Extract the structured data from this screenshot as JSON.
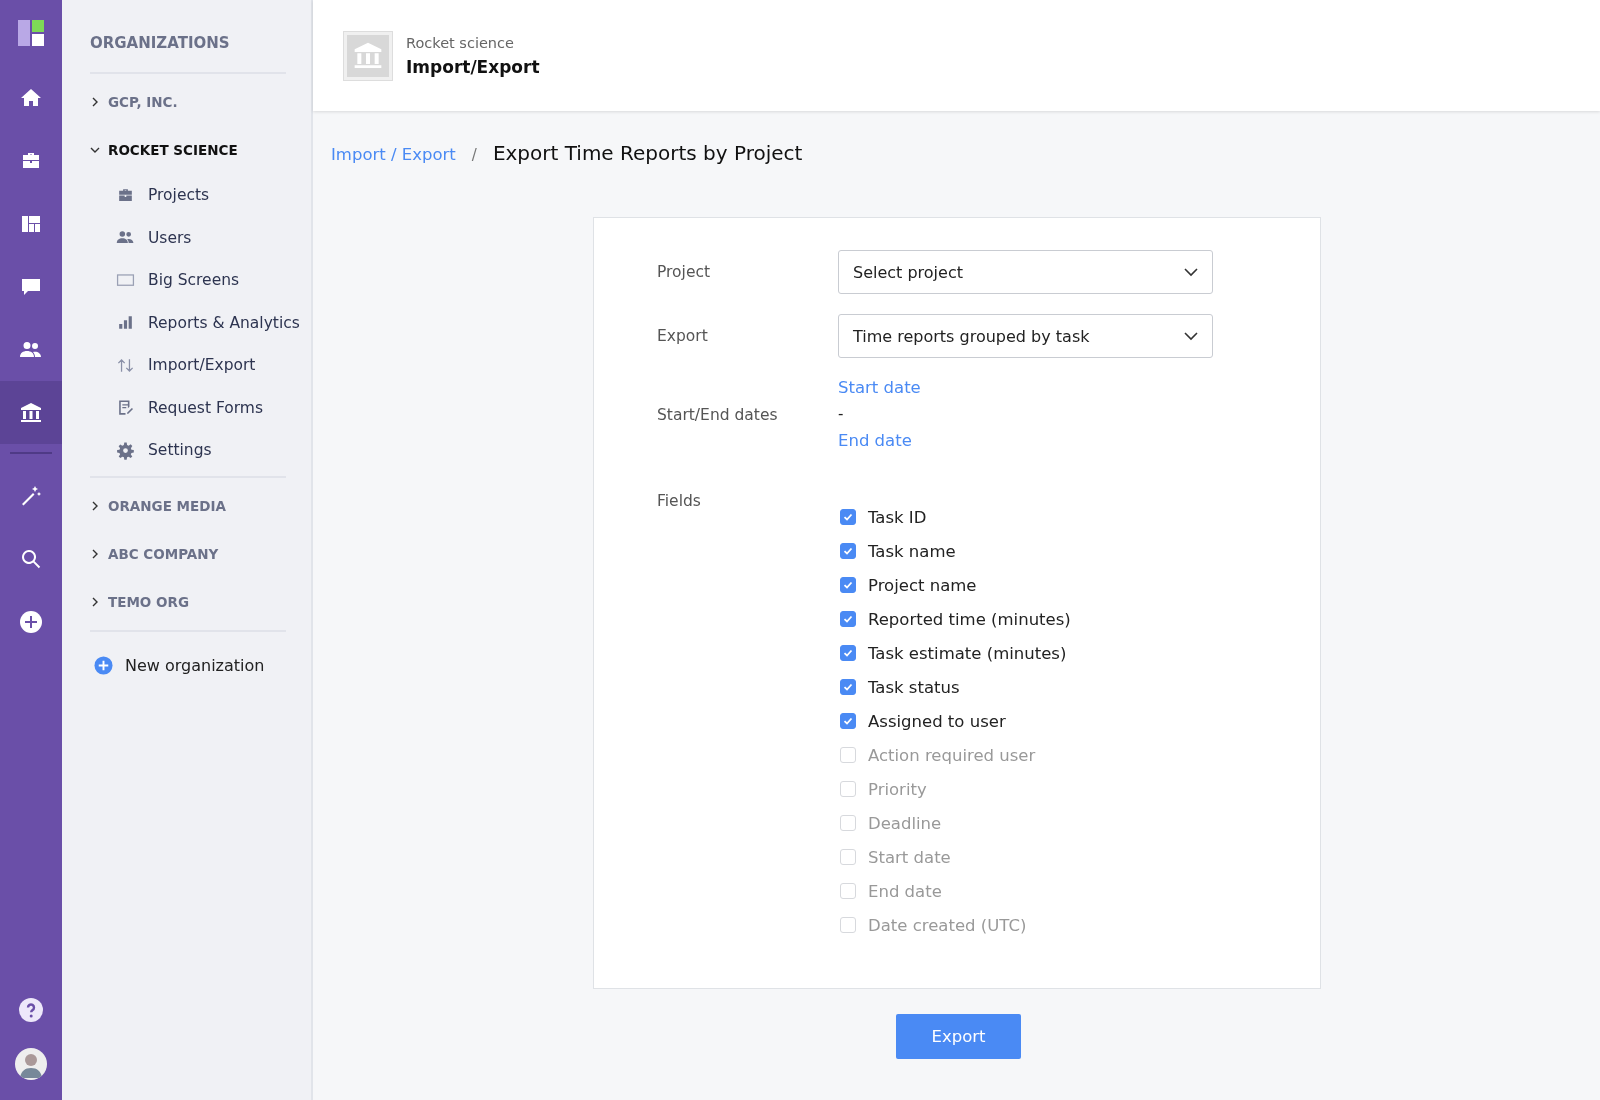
{
  "rail": {
    "items": [
      {
        "selected": false
      },
      {
        "selected": false
      },
      {
        "selected": false
      },
      {
        "selected": false
      },
      {
        "selected": false
      },
      {
        "selected": true
      },
      {
        "selected": false
      },
      {
        "selected": false
      },
      {
        "selected": false
      }
    ]
  },
  "sidebar": {
    "heading": "ORGANIZATIONS",
    "organizations": [
      {
        "name": "GCP, INC.",
        "expanded": false
      },
      {
        "name": "ROCKET SCIENCE",
        "expanded": true,
        "children": [
          {
            "label": "Projects"
          },
          {
            "label": "Users"
          },
          {
            "label": "Big Screens"
          },
          {
            "label": "Reports & Analytics"
          },
          {
            "label": "Import/Export"
          },
          {
            "label": "Request Forms"
          },
          {
            "label": "Settings"
          }
        ]
      },
      {
        "name": "ORANGE MEDIA",
        "expanded": false
      },
      {
        "name": "ABC COMPANY",
        "expanded": false
      },
      {
        "name": "TEMO ORG",
        "expanded": false
      }
    ],
    "new_organization": "New organization"
  },
  "header": {
    "subtitle": "Rocket science",
    "title": "Import/Export"
  },
  "breadcrumb": {
    "link": "Import / Export",
    "separator": "/",
    "current": "Export Time Reports by Project"
  },
  "form": {
    "project": {
      "label": "Project",
      "value": "Select project"
    },
    "export": {
      "label": "Export",
      "value": "Time reports grouped by task"
    },
    "dates": {
      "label": "Start/End dates",
      "start": "Start date",
      "separator": "-",
      "end": "End date"
    },
    "fields_label": "Fields",
    "fields": [
      {
        "label": "Task ID",
        "checked": true
      },
      {
        "label": "Task name",
        "checked": true
      },
      {
        "label": "Project name",
        "checked": true
      },
      {
        "label": "Reported time (minutes)",
        "checked": true
      },
      {
        "label": "Task estimate (minutes)",
        "checked": true
      },
      {
        "label": "Task status",
        "checked": true
      },
      {
        "label": "Assigned to user",
        "checked": true
      },
      {
        "label": "Action required user",
        "checked": false
      },
      {
        "label": "Priority",
        "checked": false
      },
      {
        "label": "Deadline",
        "checked": false
      },
      {
        "label": "Start date",
        "checked": false
      },
      {
        "label": "End date",
        "checked": false
      },
      {
        "label": "Date created (UTC)",
        "checked": false
      }
    ]
  },
  "export_button": "Export"
}
